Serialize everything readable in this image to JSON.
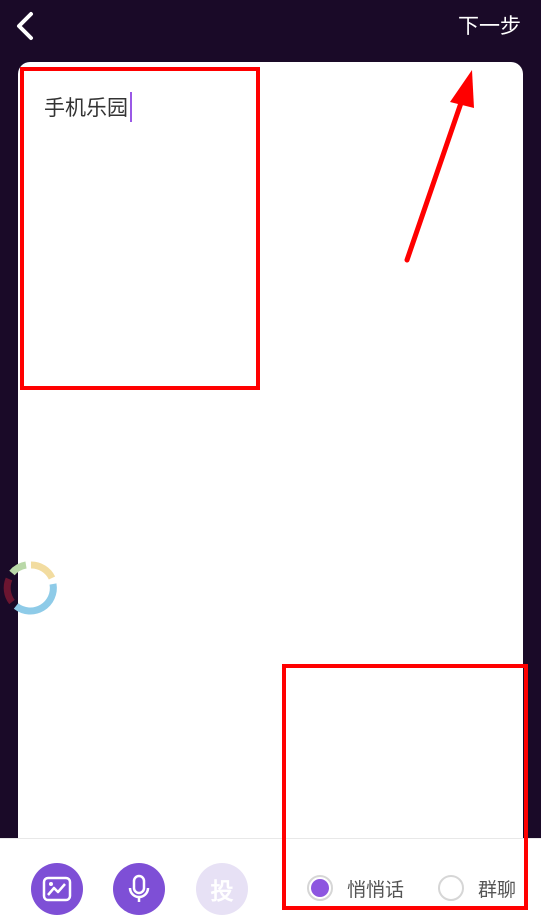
{
  "header": {
    "back_icon": "chevron-left-icon",
    "next_label": "下一步"
  },
  "editor": {
    "text": "手机乐园"
  },
  "toolbar": {
    "image_icon": "image-icon",
    "mic_icon": "microphone-icon",
    "vote_label": "投",
    "options": [
      {
        "label": "悄悄话",
        "selected": true
      },
      {
        "label": "群聊",
        "selected": false
      }
    ]
  },
  "colors": {
    "background": "#1a0a28",
    "accent": "#7e4fd6",
    "annotation": "#ff0000"
  }
}
